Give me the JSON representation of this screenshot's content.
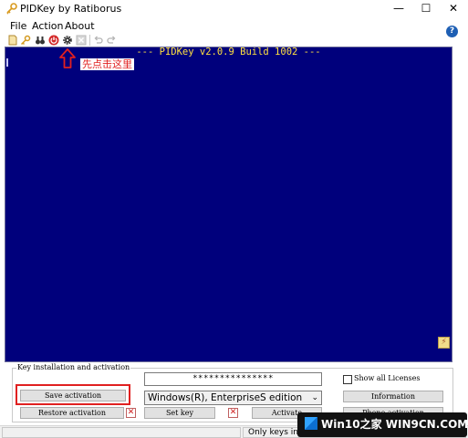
{
  "window": {
    "title": "PIDKey by Ratiborus",
    "controls": {
      "minimize": "—",
      "maximize": "☐",
      "close": "✕"
    }
  },
  "menu": [
    "File",
    "Action",
    "About"
  ],
  "toolbar": {
    "icons": [
      "new-document-icon",
      "key-icon",
      "binoculars-icon",
      "power-icon",
      "gear-icon",
      "cancel-icon",
      "undo-icon",
      "redo-icon"
    ],
    "help_label": "?"
  },
  "annotation": {
    "label": "先点击这里",
    "color": "#e02020"
  },
  "console": {
    "header": "--- PIDKey v2.0.9 Build 1002 ---",
    "background": "#00007c",
    "text_color": "#ffe040"
  },
  "key_panel": {
    "group_title": "Key installation and activation",
    "key_value": "***************",
    "edition": "Windows(R), EnterpriseS edition",
    "show_all_licenses": "Show all Licenses",
    "buttons": {
      "save_activation": "Save activation",
      "restore_activation": "Restore activation",
      "set_key": "Set key",
      "activate": "Activate",
      "information": "Information",
      "phone_activation": "Phone activation"
    }
  },
  "statusbar": {
    "text": "Only keys in the"
  },
  "watermark": {
    "text": "Win10之家 WIN9CN.COM"
  }
}
